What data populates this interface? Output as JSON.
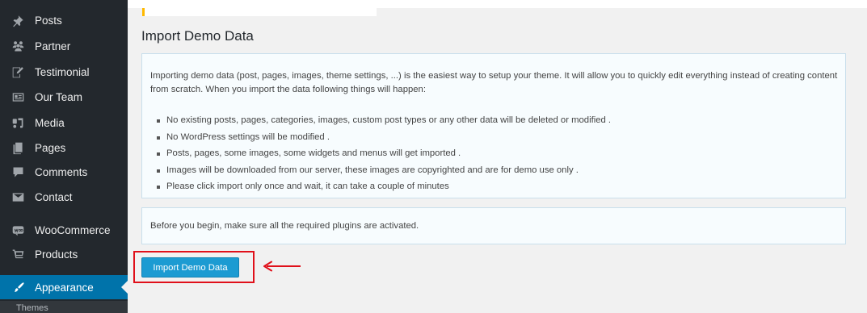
{
  "sidebar": {
    "items": [
      {
        "label": "Posts",
        "icon": "pushpin-icon"
      },
      {
        "label": "Partner",
        "icon": "groups-icon"
      },
      {
        "label": "Testimonial",
        "icon": "edit-page-icon"
      },
      {
        "label": "Our Team",
        "icon": "id-card-icon"
      },
      {
        "label": "Media",
        "icon": "media-icon"
      },
      {
        "label": "Pages",
        "icon": "pages-icon"
      },
      {
        "label": "Comments",
        "icon": "comment-icon"
      },
      {
        "label": "Contact",
        "icon": "envelope-icon"
      },
      {
        "label": "WooCommerce",
        "icon": "woocommerce-icon"
      },
      {
        "label": "Products",
        "icon": "cart-icon"
      },
      {
        "label": "Appearance",
        "icon": "paintbrush-icon",
        "active": true
      }
    ],
    "sub_peek_label": "Themes"
  },
  "page": {
    "title": "Import Demo Data",
    "intro": "Importing demo data (post, pages, images, theme settings, ...) is the easiest way to setup your theme. It will allow you to quickly edit everything instead of creating content from scratch. When you import the data following things will happen:",
    "bullets": [
      "No existing posts, pages, categories, images, custom post types or any other data will be deleted or modified .",
      "No WordPress settings will be modified .",
      "Posts, pages, some images, some widgets and menus will get imported .",
      "Images will be downloaded from our server, these images are copyrighted and are for demo use only .",
      "Please click import only once and wait, it can take a couple of minutes"
    ],
    "before_begin": "Before you begin, make sure all the required plugins are activated.",
    "import_button": "Import Demo Data"
  },
  "colors": {
    "sidebar_bg": "#23282d",
    "active_bg": "#0073aa",
    "button_bg": "#1c9bd2",
    "highlight": "#e0101a"
  }
}
